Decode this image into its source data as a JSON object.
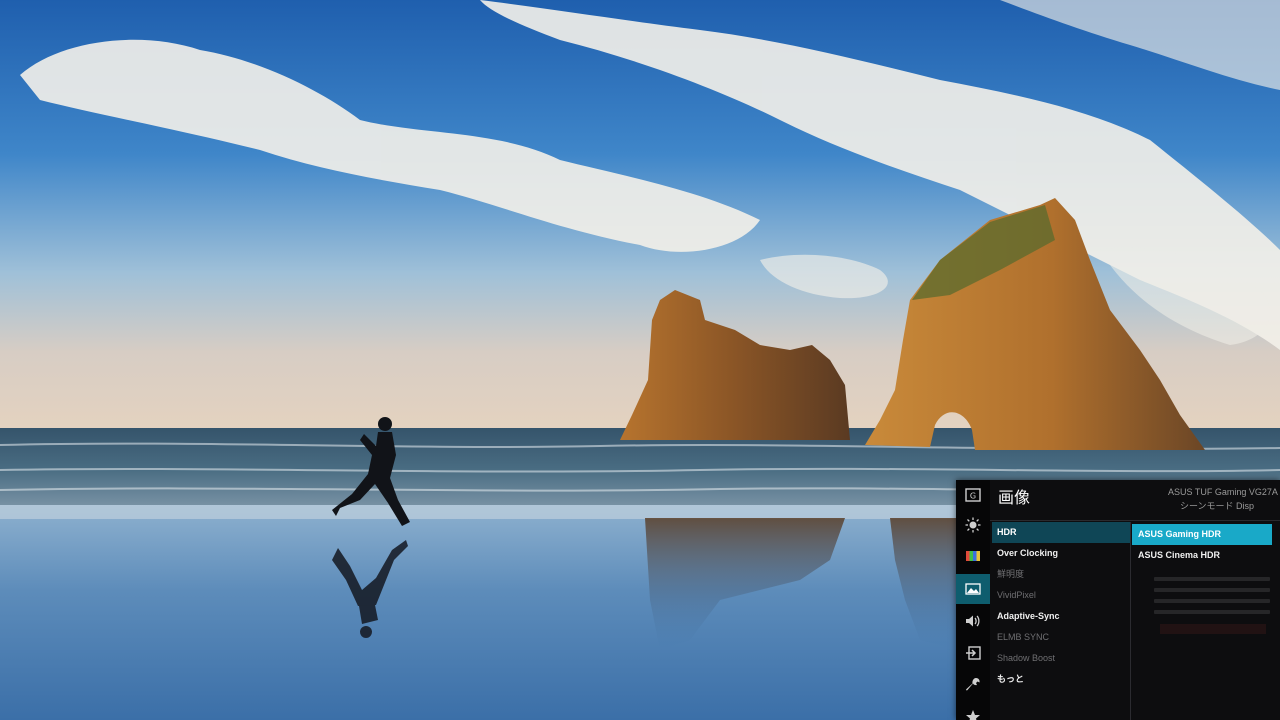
{
  "osd": {
    "title": "画像",
    "model": "ASUS TUF Gaming    VG27A",
    "submodel": "シーンモード    Disp",
    "sidebar_icons": [
      {
        "name": "gaming-icon",
        "active": false
      },
      {
        "name": "brightness-icon",
        "active": false
      },
      {
        "name": "color-icon",
        "active": false
      },
      {
        "name": "image-icon",
        "active": true
      },
      {
        "name": "sound-icon",
        "active": false
      },
      {
        "name": "input-icon",
        "active": false
      },
      {
        "name": "wrench-icon",
        "active": false
      },
      {
        "name": "star-icon",
        "active": false
      }
    ],
    "menu": [
      {
        "label": "HDR",
        "state": "selected"
      },
      {
        "label": "Over Clocking",
        "state": "enabled"
      },
      {
        "label": "鮮明度",
        "state": "disabled"
      },
      {
        "label": "VividPixel",
        "state": "disabled"
      },
      {
        "label": "Adaptive-Sync",
        "state": "enabled"
      },
      {
        "label": "ELMB SYNC",
        "state": "disabled"
      },
      {
        "label": "Shadow Boost",
        "state": "disabled"
      },
      {
        "label": "もっと",
        "state": "enabled"
      }
    ],
    "submenu": [
      {
        "label": "ASUS Gaming HDR",
        "state": "selected"
      },
      {
        "label": "ASUS Cinema HDR",
        "state": "enabled"
      }
    ],
    "colors": {
      "panel": "#0d0d0f",
      "menu_highlight": "#0f4656",
      "submenu_highlight": "#19a9c8",
      "icon_active": "#0e5d6e"
    }
  }
}
